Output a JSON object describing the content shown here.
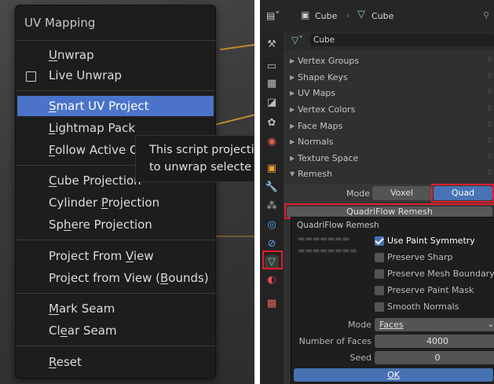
{
  "uv_menu": {
    "title": "UV Mapping",
    "items": [
      {
        "pre": "",
        "u": "U",
        "post": "nwrap"
      },
      {
        "pre": "Live Unwrap",
        "u": "",
        "post": ""
      },
      {
        "pre": "",
        "u": "S",
        "post": "mart UV Project"
      },
      {
        "pre": "",
        "u": "L",
        "post": "ightmap Pack"
      },
      {
        "pre": "",
        "u": "F",
        "post": "ollow Active Q"
      },
      {
        "pre": "",
        "u": "C",
        "post": "ube Projection"
      },
      {
        "pre": "Cylinder ",
        "u": "P",
        "post": "rojection"
      },
      {
        "pre": "Sp",
        "u": "h",
        "post": "ere Projection"
      },
      {
        "pre": "Project From ",
        "u": "V",
        "post": "iew"
      },
      {
        "pre": "Project from View (",
        "u": "B",
        "post": "ounds)"
      },
      {
        "pre": "",
        "u": "M",
        "post": "ark Seam"
      },
      {
        "pre": "Cl",
        "u": "e",
        "post": "ar Seam"
      },
      {
        "pre": "",
        "u": "R",
        "post": "eset"
      }
    ],
    "tooltip_lines": [
      "This script projecti",
      "to unwrap selecte"
    ]
  },
  "properties": {
    "header": {
      "object_name": "Cube",
      "data_name": "Cube"
    },
    "sub_header": {
      "object_field": "Cube"
    },
    "panels": [
      "Vertex Groups",
      "Shape Keys",
      "UV Maps",
      "Vertex Colors",
      "Face Maps",
      "Normals",
      "Texture Space",
      "Remesh"
    ],
    "remesh": {
      "mode_label": "Mode",
      "mode_options": [
        "Voxel",
        "Quad"
      ],
      "selected_mode": "Quad",
      "quadriflow_button": "QuadriFlow Remesh"
    },
    "popup": {
      "title": "QuadriFlow Remesh",
      "checks": [
        {
          "label": "Use Paint Symmetry",
          "checked": true
        },
        {
          "label": "Preserve Sharp",
          "checked": false
        },
        {
          "label": "Preserve Mesh Boundary",
          "checked": false
        },
        {
          "label": "Preserve Paint Mask",
          "checked": false
        },
        {
          "label": "Smooth Normals",
          "checked": false
        }
      ],
      "mode_label": "Mode",
      "mode_value": "Faces",
      "faces_label": "Number of Faces",
      "faces_value": "4000",
      "seed_label": "Seed",
      "seed_value": "0",
      "ok_label": "OK"
    },
    "colors": {
      "accent": "#4772b3",
      "highlight": "#e01e2a"
    }
  }
}
